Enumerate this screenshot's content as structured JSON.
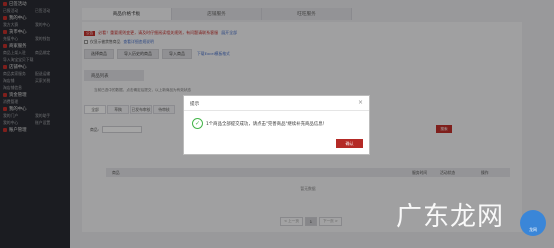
{
  "sidebar": {
    "groups": [
      {
        "title": "已签活动",
        "rows": [
          [
            "已报活动",
            "已签活动"
          ]
        ]
      },
      {
        "title": "我的中心",
        "rows": [
          [
            "我方大赛",
            "我的中心"
          ]
        ]
      },
      {
        "title": "货币中心",
        "rows": [
          [
            "充值中心",
            "我的钱包"
          ]
        ]
      },
      {
        "title": "商家服务",
        "rows": [
          [
            "商品上架入驻",
            "商品绑定"
          ],
          [
            "导入淘宝宝贝下载",
            ""
          ]
        ]
      },
      {
        "title": "店铺中心",
        "rows": [
          [
            "商品卖家服务",
            "配送运输"
          ],
          [
            "淘店铺",
            "买家关税"
          ],
          [
            "淘店铺信息",
            ""
          ]
        ]
      },
      {
        "title": "资金管理",
        "rows": [
          [
            "消费管理",
            ""
          ]
        ]
      },
      {
        "title": "我的中心",
        "rows": [
          [
            "我的门户",
            "我的助手"
          ],
          [
            "我的中心",
            "账户设置"
          ]
        ]
      },
      {
        "title": "账户管理",
        "rows": []
      }
    ]
  },
  "tabs": [
    "商品价格卡板",
    "店铺服务",
    "旺旺服务"
  ],
  "notice": {
    "badge": "公告",
    "text": "必看！重要规则变更，请及时仔细阅读相关规则，有问题请联系客服",
    "link": "展开全部"
  },
  "checkbox": {
    "label": "仅显示被禁售商品",
    "link": "查看详细违规说明"
  },
  "buttons": {
    "b1": "选择商品",
    "b2": "导入历史的商品",
    "b3": "导入商品",
    "link": "下载Excel模板格式"
  },
  "subhead": "商品列表",
  "info": "当前已选中的数据，点击确定后提交，以上新商品为有效状态",
  "filters": [
    "全部",
    "草稿",
    "已发布审核",
    "待审核"
  ],
  "search": {
    "label": "商品:",
    "button": "搜索"
  },
  "table": {
    "col1": "商品",
    "col2": "服务时间",
    "col3": "活动状态",
    "col4": "操作",
    "empty": "暂无数据"
  },
  "pager": {
    "prev": "< 上一页",
    "current": "1",
    "next": "下一页 >"
  },
  "modal": {
    "title": "提示",
    "message": "1个商品全部提交成功，请点击\"完善商品\"继续补充商品信息！",
    "ok": "确认"
  },
  "watermark": {
    "text": "广东龙网",
    "logo": "龙网"
  }
}
